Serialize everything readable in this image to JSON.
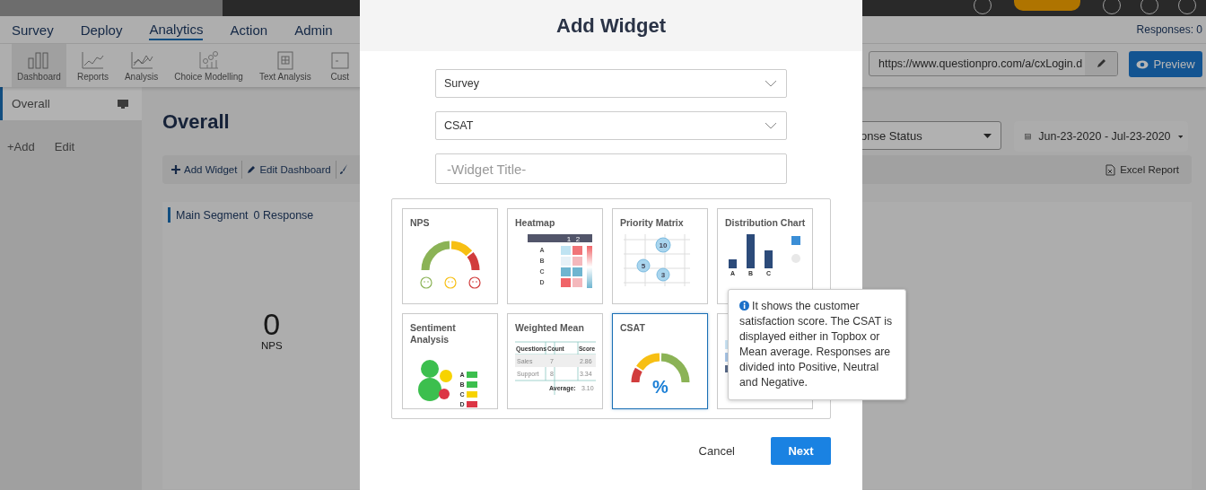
{
  "nav": [
    {
      "label": "Survey",
      "selected": false
    },
    {
      "label": "Deploy",
      "selected": false
    },
    {
      "label": "Analytics",
      "selected": true
    },
    {
      "label": "Action",
      "selected": false
    },
    {
      "label": "Admin",
      "selected": false
    }
  ],
  "responses": "Responses: 0",
  "toolbar": [
    {
      "label": "Dashboard",
      "selected": true
    },
    {
      "label": "Reports",
      "selected": false
    },
    {
      "label": "Analysis",
      "selected": false
    },
    {
      "label": "Choice Modelling",
      "selected": false
    },
    {
      "label": "Text Analysis",
      "selected": false
    },
    {
      "label": "Cust",
      "selected": false
    }
  ],
  "url_field": {
    "value": "https://www.questionpro.com/a/cxLogin.d"
  },
  "preview_button": "Preview",
  "sidebar": {
    "items": [
      {
        "label": "Overall",
        "selected": true
      }
    ],
    "actions": [
      "+Add",
      "Edit"
    ]
  },
  "page_title": "Overall",
  "filter": {
    "value": "onse Status"
  },
  "date_range": "Jun-23-2020 - Jul-23-2020",
  "dashboard_actions": [
    "Add Widget",
    "Edit Dashboard"
  ],
  "excel_report": "Excel Report",
  "segment": {
    "title": "Main Segment",
    "count": "0 Response",
    "value": "0",
    "label": "NPS"
  },
  "modal": {
    "title": "Add Widget",
    "survey_select": "Survey",
    "type_select": "CSAT",
    "title_field": {
      "placeholder": "-Widget Title-"
    },
    "widgets": [
      {
        "kind": "nps",
        "title": "NPS",
        "selected": false
      },
      {
        "kind": "heatmap",
        "title": "Heatmap",
        "selected": false,
        "labels": [
          "1",
          "2",
          "A",
          "B",
          "C",
          "D"
        ]
      },
      {
        "kind": "priority",
        "title": "Priority Matrix",
        "selected": false,
        "labels": [
          "10",
          "5",
          "3"
        ]
      },
      {
        "kind": "distribution",
        "title": "Distribution Chart",
        "selected": false,
        "labels": [
          "A",
          "B",
          "C"
        ]
      },
      {
        "kind": "sentiment",
        "title": "Sentiment Analysis",
        "selected": false,
        "labels": [
          "A",
          "B",
          "C",
          "D"
        ]
      },
      {
        "kind": "weighted",
        "title": "Weighted Mean",
        "selected": false,
        "labels": [
          "Questions",
          "Count",
          "Score",
          "Sales",
          "7",
          "2.86",
          "Support",
          "8",
          "3.34",
          "Average:",
          "3.10"
        ]
      },
      {
        "kind": "csat",
        "title": "CSAT",
        "selected": true,
        "labels": [
          "%"
        ]
      },
      {
        "kind": "tracker",
        "selected": false
      }
    ],
    "tooltip": "It shows the customer satisfaction score. The CSAT is displayed either in Topbox or Mean average. Responses are divided into Positive, Neutral and Negative.",
    "cancel": "Cancel",
    "next": "Next"
  }
}
